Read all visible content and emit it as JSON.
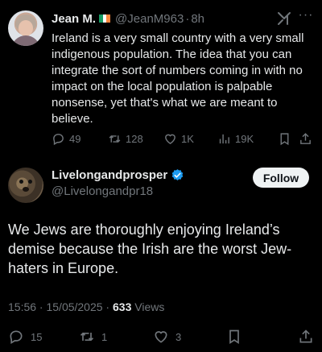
{
  "post1": {
    "author_name": "Jean M.",
    "flag_colors": [
      "#169b62",
      "#ffffff",
      "#ff883e"
    ],
    "handle": "@JeanM963",
    "separator": "·",
    "time": "8h",
    "text": "Ireland is a very small country with a very small indigenous population. The idea that you can integrate the sort of numbers coming in with no impact on the local population is palpable nonsense, yet that's what we are meant to believe.",
    "more_label": "···",
    "actions": {
      "replies": "49",
      "reposts": "128",
      "likes": "1K",
      "views": "19K"
    }
  },
  "post2": {
    "author_name": "Livelongandprosper",
    "handle": "@Livelongandpr18",
    "follow_label": "Follow",
    "text": "We Jews are thoroughly enjoying Ireland’s demise because the Irish are the worst Jew-haters in Europe.",
    "timestamp": "15:56 · 15/05/2025 · ",
    "views_count": "633",
    "views_label": " Views",
    "actions": {
      "replies": "15",
      "reposts": "1",
      "likes": "3"
    }
  },
  "colors": {
    "background": "#000000",
    "text_primary": "#e7e9ea",
    "text_secondary": "#71767b",
    "verified_blue": "#1d9bf0"
  }
}
